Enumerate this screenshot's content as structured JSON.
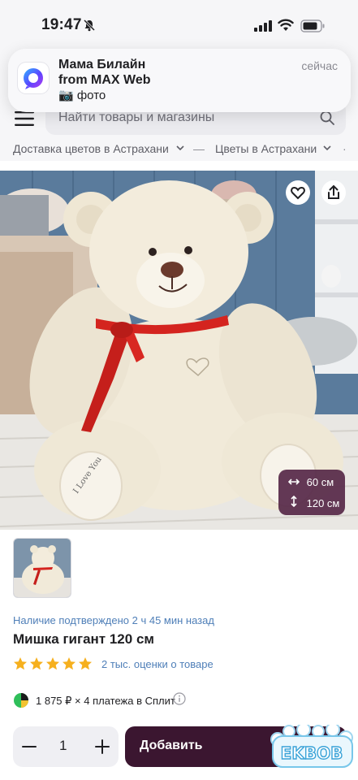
{
  "status_bar": {
    "time": "19:47"
  },
  "notification": {
    "title": "Мама Билайн",
    "subtitle": "from MAX Web",
    "body": "📷 фото",
    "time": "сейчас",
    "app_icon": "max-app-icon"
  },
  "search": {
    "placeholder": "Найти товары и магазины"
  },
  "breadcrumbs": [
    {
      "label": "Доставка цветов в Астрахани"
    },
    {
      "label": "Цветы в Астрахани"
    }
  ],
  "product": {
    "size_width": "60 см",
    "size_height": "120 см",
    "availability": "Наличие подтверждено 2 ч 45 мин назад",
    "title": "Мишка гигант 120 см",
    "rating_stars": 5,
    "rating_link": "2 тыс. оценки о товаре",
    "split_text": "1 875 ₽ × 4 платежа в Сплит"
  },
  "cart": {
    "quantity": "1",
    "add_label": "Добавить"
  },
  "watermark": {
    "text": "EKBOB"
  },
  "colors": {
    "accent_dark": "#3b1630",
    "link_blue": "#4f7fb8",
    "star": "#f6b01e",
    "badge": "#562848"
  }
}
